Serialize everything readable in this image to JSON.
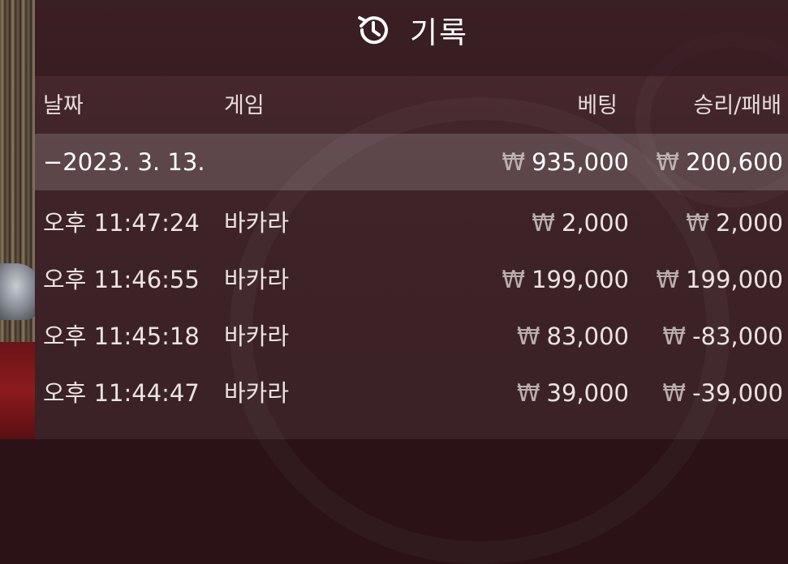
{
  "header": {
    "icon": "history-icon",
    "title": "기록"
  },
  "columns": {
    "date": "날짜",
    "game": "게임",
    "bet": "베팅",
    "winloss": "승리/패배"
  },
  "summary": {
    "date": "−2023. 3. 13.",
    "bet": "935,000",
    "winloss": "200,600"
  },
  "currency": "₩",
  "rows": [
    {
      "time": "오후 11:47:24",
      "game": "바카라",
      "bet": "2,000",
      "winloss": "2,000"
    },
    {
      "time": "오후 11:46:55",
      "game": "바카라",
      "bet": "199,000",
      "winloss": "199,000"
    },
    {
      "time": "오후 11:45:18",
      "game": "바카라",
      "bet": "83,000",
      "winloss": "-83,000"
    },
    {
      "time": "오후 11:44:47",
      "game": "바카라",
      "bet": "39,000",
      "winloss": "-39,000"
    }
  ],
  "colors": {
    "panel": "#3e2328",
    "header": "#2d161b",
    "text": "#ece4e4"
  }
}
